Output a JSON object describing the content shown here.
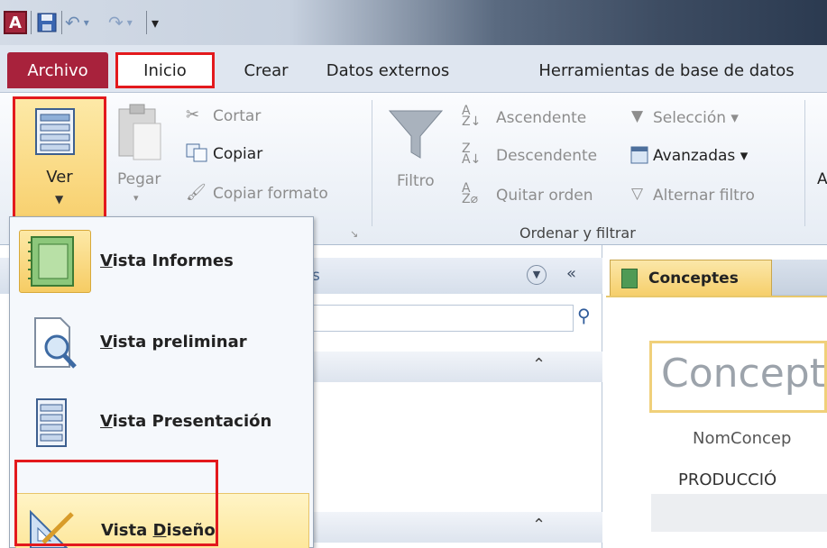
{
  "quick_access": {
    "app_icon_letter": "A",
    "customize": "▾"
  },
  "tabs": {
    "archivo": "Archivo",
    "inicio": "Inicio",
    "crear": "Crear",
    "datos_externos": "Datos externos",
    "herramientas": "Herramientas de base de datos"
  },
  "ribbon": {
    "ver": "Ver",
    "pegar": "Pegar",
    "cortar": "Cortar",
    "copiar": "Copiar",
    "copiar_formato": "Copiar formato",
    "filtro": "Filtro",
    "ascendente": "Ascendente",
    "descendente": "Descendente",
    "quitar_orden": "Quitar orden",
    "seleccion": "Selección",
    "avanzadas": "Avanzadas",
    "alternar_filtro": "Alternar filtro",
    "ordenar_filtrar_label": "Ordenar y filtrar",
    "cut_off_letter": "A"
  },
  "nav_pane": {
    "header_fragment": "s"
  },
  "document": {
    "tab_label": "Conceptes",
    "report_title": "Concepte",
    "field_label": "NomConcep",
    "field_value": "PRODUCCIÓ"
  },
  "view_menu": {
    "items": [
      {
        "accel": "V",
        "rest": "ista Informes"
      },
      {
        "accel": "V",
        "rest": "ista preliminar"
      },
      {
        "accel": "V",
        "rest": "ista Presentación"
      },
      {
        "prefix": "Vista ",
        "accel": "D",
        "rest": "iseño"
      }
    ]
  },
  "colors": {
    "archivo_tab": "#a8223c",
    "highlight_border": "#e3191d",
    "selected_gold": "#f8d06e"
  }
}
